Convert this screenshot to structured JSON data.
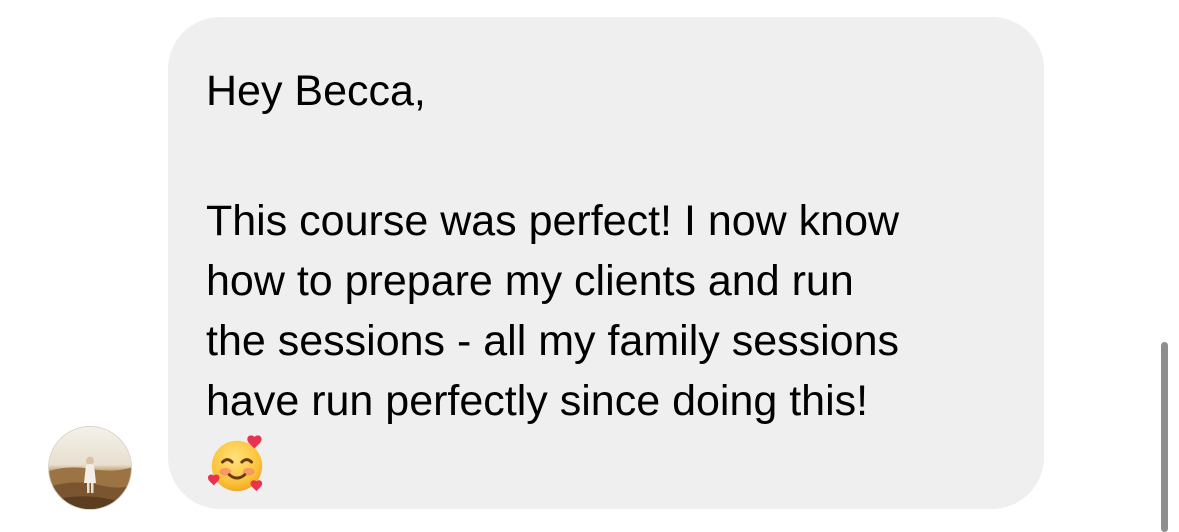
{
  "message": {
    "greeting": "Hey Becca,",
    "body_lines": [
      "This course was perfect! I now know",
      "how to prepare my clients and run",
      "the sessions - all my family sessions",
      "have run perfectly since doing this!"
    ],
    "emoji_icon": "smiling-face-with-hearts-icon"
  },
  "sender": {
    "avatar_icon": "profile-photo-avatar"
  },
  "colors": {
    "bubble": "#efefef",
    "text": "#000000",
    "scrollbar": "#8e8e8e"
  }
}
